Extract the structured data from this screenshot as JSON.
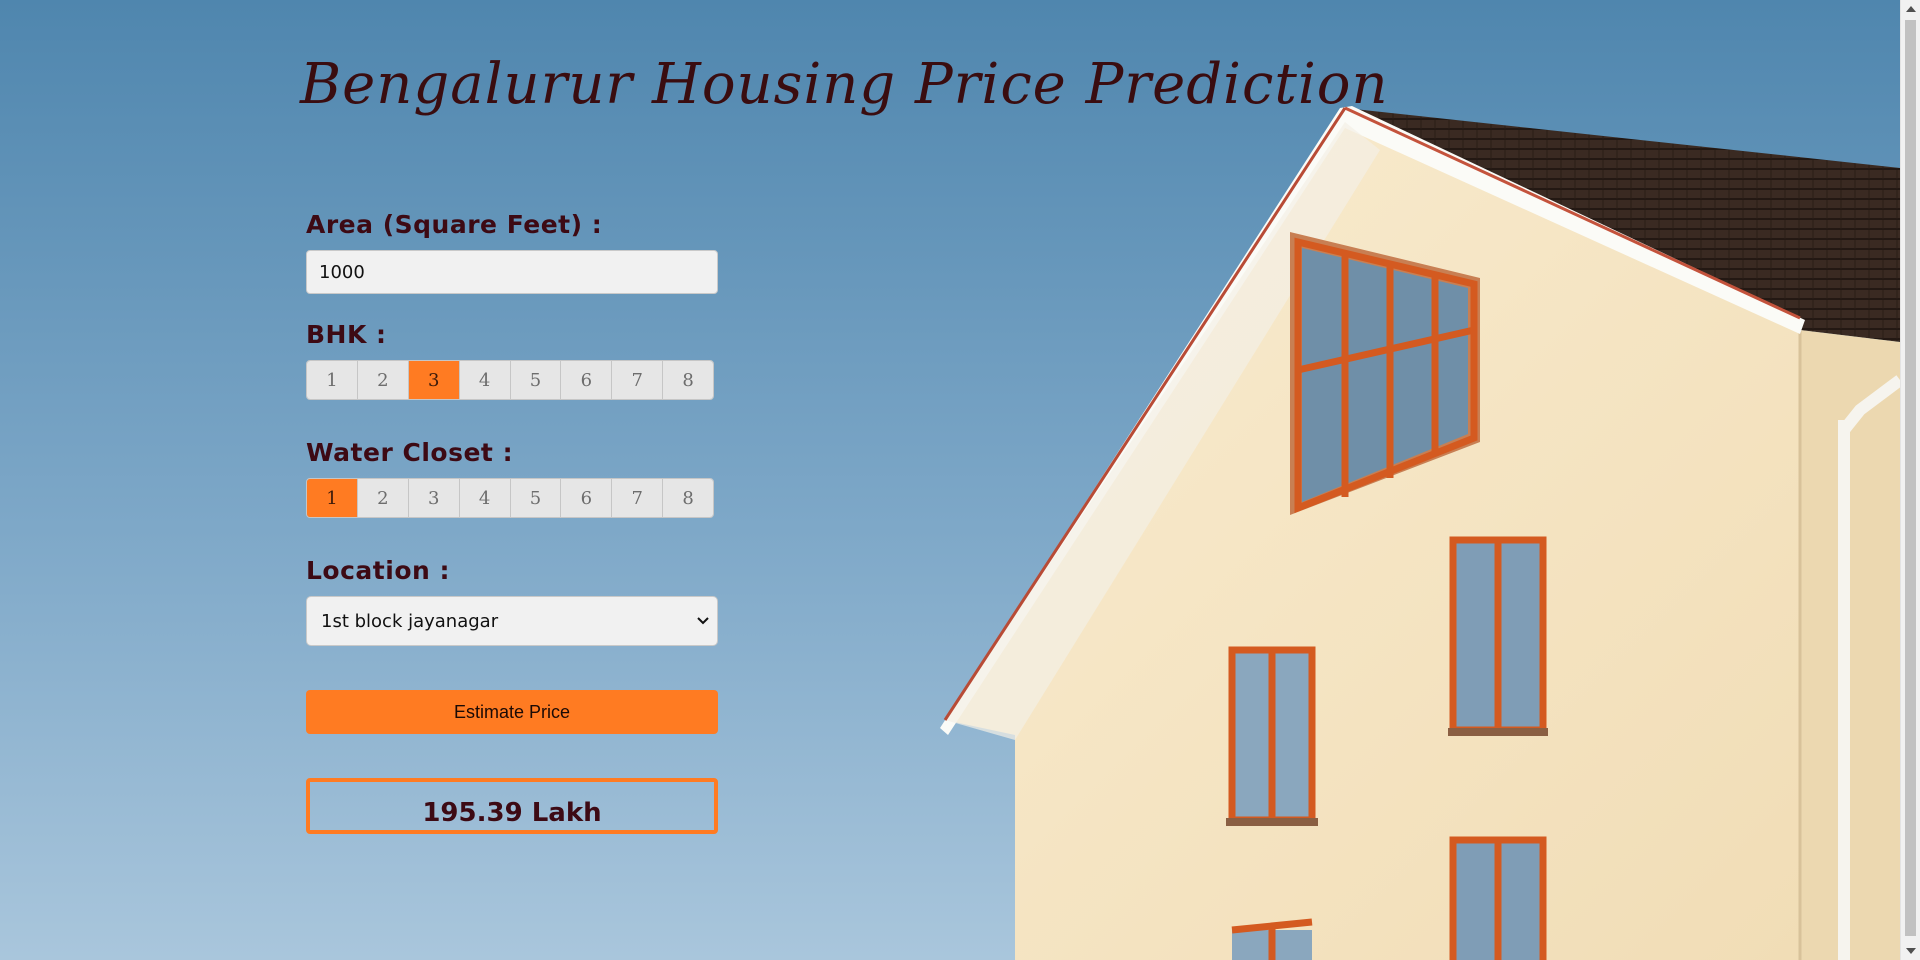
{
  "page": {
    "title": "Bengalurur Housing Price Prediction"
  },
  "form": {
    "area": {
      "label": "Area (Square Feet) :",
      "value": "1000"
    },
    "bhk": {
      "label": "BHK :",
      "options": [
        "1",
        "2",
        "3",
        "4",
        "5",
        "6",
        "7",
        "8"
      ],
      "selected": "3"
    },
    "bath": {
      "label": "Water Closet :",
      "options": [
        "1",
        "2",
        "3",
        "4",
        "5",
        "6",
        "7",
        "8"
      ],
      "selected": "1"
    },
    "location": {
      "label": "Location :",
      "selected": "1st block jayanagar"
    },
    "estimate_button": "Estimate Price"
  },
  "result": {
    "text": "195.39 Lakh"
  },
  "colors": {
    "accent": "#ff7b22",
    "label": "#3d0a14",
    "sky_top": "#4f86ae",
    "sky_bottom": "#a7c6dc",
    "wall": "#f5e6c4",
    "roof": "#3b2a22",
    "window_frame": "#d45a20"
  }
}
